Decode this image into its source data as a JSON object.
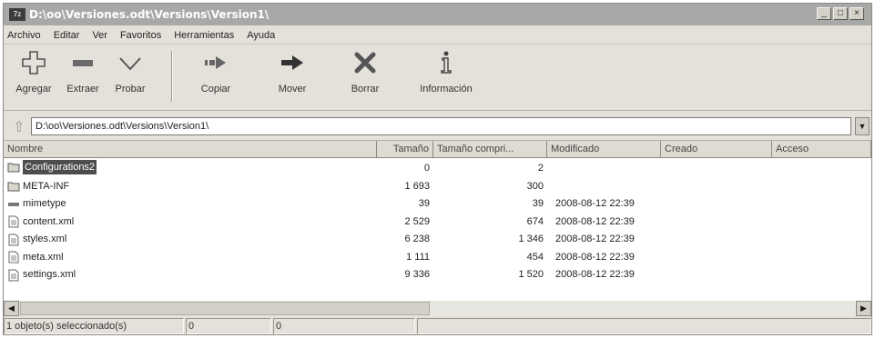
{
  "window": {
    "title": "D:\\oo\\Versiones.odt\\Versions\\Version1\\",
    "app_icon": "7z"
  },
  "window_buttons": {
    "minimize": "_",
    "maximize": "□",
    "close": "×"
  },
  "menu": [
    "Archivo",
    "Editar",
    "Ver",
    "Favoritos",
    "Herramientas",
    "Ayuda"
  ],
  "toolbar": {
    "add": "Agregar",
    "extract": "Extraer",
    "test": "Probar",
    "copy": "Copiar",
    "move": "Mover",
    "delete": "Borrar",
    "info": "Información"
  },
  "address": {
    "path": "D:\\oo\\Versiones.odt\\Versions\\Version1\\"
  },
  "columns": [
    "Nombre",
    "Tamaño",
    "Tamaño compri...",
    "Modificado",
    "Creado",
    "Acceso"
  ],
  "rows": [
    {
      "name": "Configurations2",
      "size": "0",
      "packed": "2",
      "modified": "",
      "type": "folder",
      "selected": true
    },
    {
      "name": "META-INF",
      "size": "1 693",
      "packed": "300",
      "modified": "",
      "type": "folder",
      "selected": false
    },
    {
      "name": "mimetype",
      "size": "39",
      "packed": "39",
      "modified": "2008-08-12 22:39",
      "type": "file-plain",
      "selected": false
    },
    {
      "name": "content.xml",
      "size": "2 529",
      "packed": "674",
      "modified": "2008-08-12 22:39",
      "type": "file-xml",
      "selected": false
    },
    {
      "name": "styles.xml",
      "size": "6 238",
      "packed": "1 346",
      "modified": "2008-08-12 22:39",
      "type": "file-xml",
      "selected": false
    },
    {
      "name": "meta.xml",
      "size": "1 111",
      "packed": "454",
      "modified": "2008-08-12 22:39",
      "type": "file-xml",
      "selected": false
    },
    {
      "name": "settings.xml",
      "size": "9 336",
      "packed": "1 520",
      "modified": "2008-08-12 22:39",
      "type": "file-xml",
      "selected": false
    }
  ],
  "status": {
    "selection": "1 objeto(s) seleccionado(s)",
    "size": "0",
    "packed": "0"
  }
}
